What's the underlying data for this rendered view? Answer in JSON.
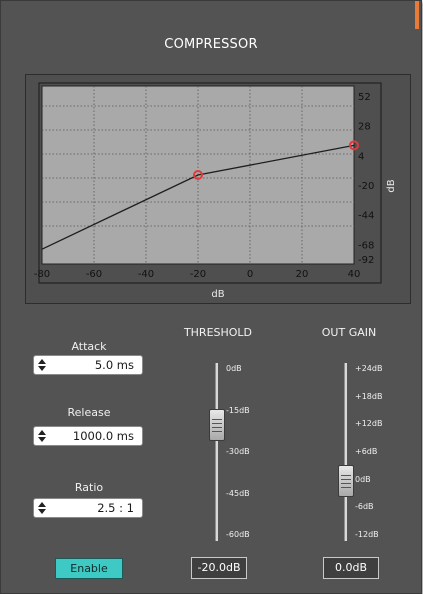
{
  "window": {
    "title": "COMPRESSOR",
    "accent_color": "#e87a3a"
  },
  "chart_data": {
    "type": "line",
    "x_ticks": [
      "-80",
      "-60",
      "-40",
      "-20",
      "0",
      "20",
      "40"
    ],
    "y_ticks": [
      "52",
      "28",
      "4",
      "-20",
      "-44",
      "-68",
      "-92"
    ],
    "xlabel": "dB",
    "ylabel": "dB",
    "xlim": [
      -80,
      40
    ],
    "ylim": [
      -92,
      52
    ],
    "series": [
      {
        "x": [
          -80,
          -20,
          40
        ],
        "y": [
          -80,
          -20,
          4
        ]
      }
    ],
    "markers": [
      {
        "x": -20,
        "y": -20
      },
      {
        "x": 40,
        "y": 4
      }
    ],
    "grid": true,
    "plot_bg": "#a9a9a9",
    "curve_color": "#1e1e1e",
    "marker_color": "#e23a3a"
  },
  "controls": {
    "attack": {
      "label": "Attack",
      "value": "5.0 ms"
    },
    "release": {
      "label": "Release",
      "value": "1000.0 ms"
    },
    "ratio": {
      "label": "Ratio",
      "value": "2.5 : 1"
    },
    "enable": {
      "label": "Enable",
      "color": "#3fc9c4"
    }
  },
  "threshold": {
    "header": "THRESHOLD",
    "ticks": [
      "0dB",
      "-15dB",
      "-30dB",
      "-45dB",
      "-60dB"
    ],
    "value": "-20.0dB",
    "level_db": -20,
    "range_db": [
      -60,
      0
    ]
  },
  "out_gain": {
    "header": "OUT GAIN",
    "ticks": [
      "+24dB",
      "+18dB",
      "+12dB",
      "+6dB",
      "0dB",
      "-6dB",
      "-12dB"
    ],
    "value": "0.0dB",
    "level_db": 0,
    "range_db": [
      -12,
      24
    ]
  }
}
